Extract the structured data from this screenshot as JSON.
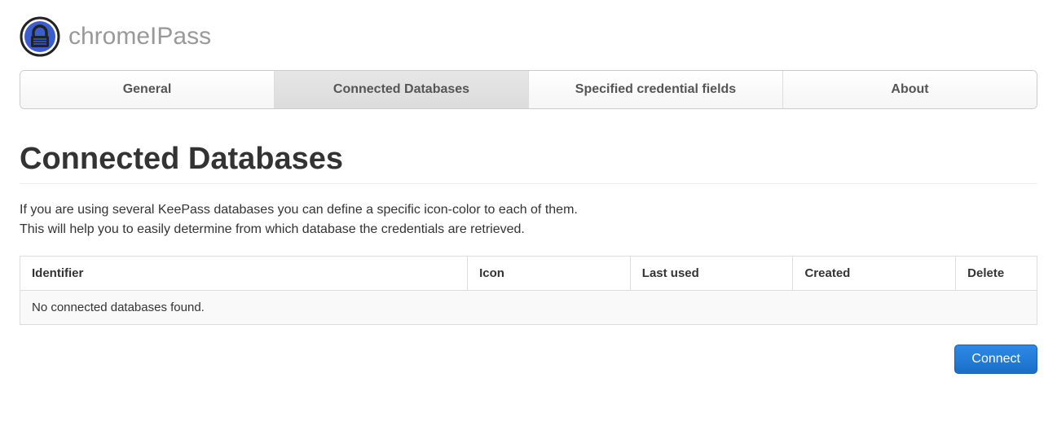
{
  "header": {
    "app_name": "chromeIPass"
  },
  "tabs": {
    "general": "General",
    "connected_databases": "Connected Databases",
    "specified_credential_fields": "Specified credential fields",
    "about": "About",
    "active": "connected_databases"
  },
  "main": {
    "title": "Connected Databases",
    "description_line1": "If you are using several KeePass databases you can define a specific icon-color to each of them.",
    "description_line2": "This will help you to easily determine from which database the credentials are retrieved.",
    "table": {
      "headers": {
        "identifier": "Identifier",
        "icon": "Icon",
        "last_used": "Last used",
        "created": "Created",
        "delete": "Delete"
      },
      "empty_message": "No connected databases found."
    },
    "connect_button": "Connect"
  }
}
